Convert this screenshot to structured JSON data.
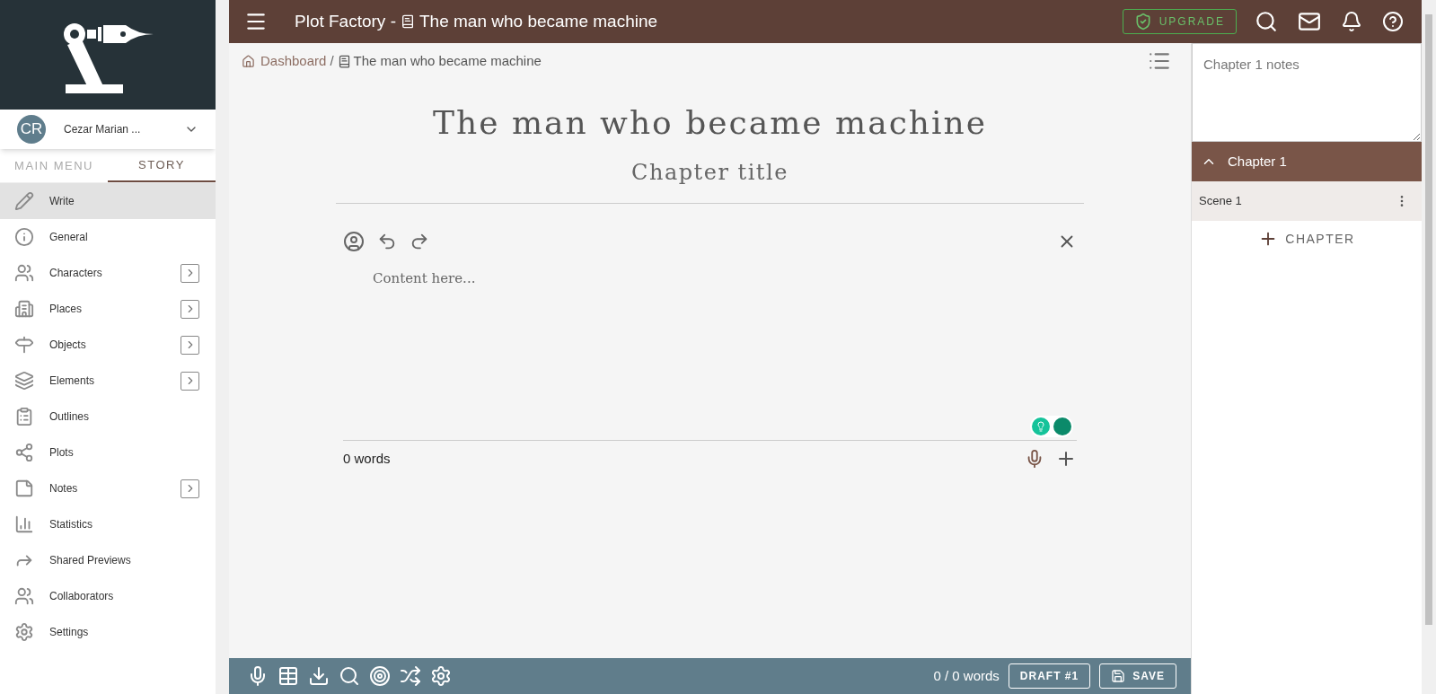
{
  "topbar": {
    "app_name": "Plot Factory -",
    "book_title": "The man who became machine",
    "upgrade": "UPGRADE"
  },
  "sidebar": {
    "user": {
      "initials": "CR",
      "name": "Cezar Marian ..."
    },
    "tabs": [
      {
        "label": "MAIN MENU",
        "selected": false
      },
      {
        "label": "STORY",
        "selected": true
      }
    ],
    "items": [
      {
        "label": "Write",
        "selected": true,
        "submenu": false
      },
      {
        "label": "General",
        "selected": false,
        "submenu": false
      },
      {
        "label": "Characters",
        "selected": false,
        "submenu": true
      },
      {
        "label": "Places",
        "selected": false,
        "submenu": true
      },
      {
        "label": "Objects",
        "selected": false,
        "submenu": true
      },
      {
        "label": "Elements",
        "selected": false,
        "submenu": true
      },
      {
        "label": "Outlines",
        "selected": false,
        "submenu": false
      },
      {
        "label": "Plots",
        "selected": false,
        "submenu": false
      },
      {
        "label": "Notes",
        "selected": false,
        "submenu": true
      },
      {
        "label": "Statistics",
        "selected": false,
        "submenu": false
      },
      {
        "label": "Shared Previews",
        "selected": false,
        "submenu": false
      },
      {
        "label": "Collaborators",
        "selected": false,
        "submenu": false
      },
      {
        "label": "Settings",
        "selected": false,
        "submenu": false
      }
    ]
  },
  "breadcrumb": [
    "Dashboard",
    "/",
    "The man who became machine"
  ],
  "editor": {
    "book_title": "The man who became machine",
    "chapter_title": "Chapter title",
    "placeholder": "Content here...",
    "word_count": "0 words"
  },
  "bottom_bar": {
    "total": "0 / 0 words",
    "draft": "DRAFT #1",
    "save": "SAVE"
  },
  "right_panel": {
    "notes_placeholder": "Chapter 1 notes",
    "chapters": [
      {
        "title": "Chapter 1",
        "expanded": true,
        "scenes": [
          {
            "title": "Scene 1",
            "selected": true
          }
        ]
      }
    ],
    "add_chapter": "CHAPTER"
  }
}
